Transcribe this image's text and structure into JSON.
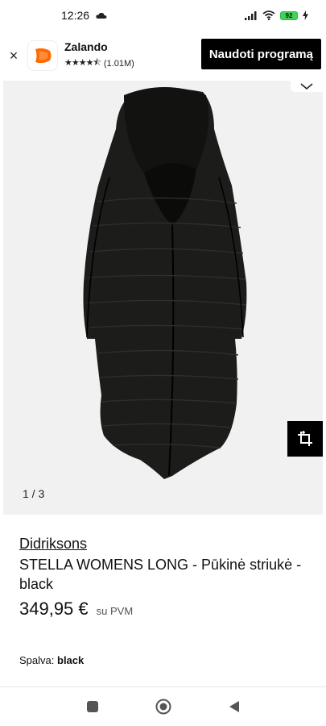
{
  "status": {
    "time": "12:26",
    "battery": "92"
  },
  "app_banner": {
    "close_symbol": "×",
    "app_name": "Zalando",
    "stars": "★★★★⯪",
    "rating_count": "(1.01M)",
    "open_app_label": "Naudoti programą"
  },
  "gallery": {
    "counter": "1 / 3"
  },
  "product": {
    "brand": "Didriksons",
    "name": "STELLA WOMENS LONG - Pūkinė striukė - black",
    "price": "349,95 €",
    "vat_note": "su PVM",
    "color_label": "Spalva:",
    "color_value": "black"
  },
  "colors": {
    "logo_orange": "#ff6900",
    "button_black": "#000000"
  }
}
